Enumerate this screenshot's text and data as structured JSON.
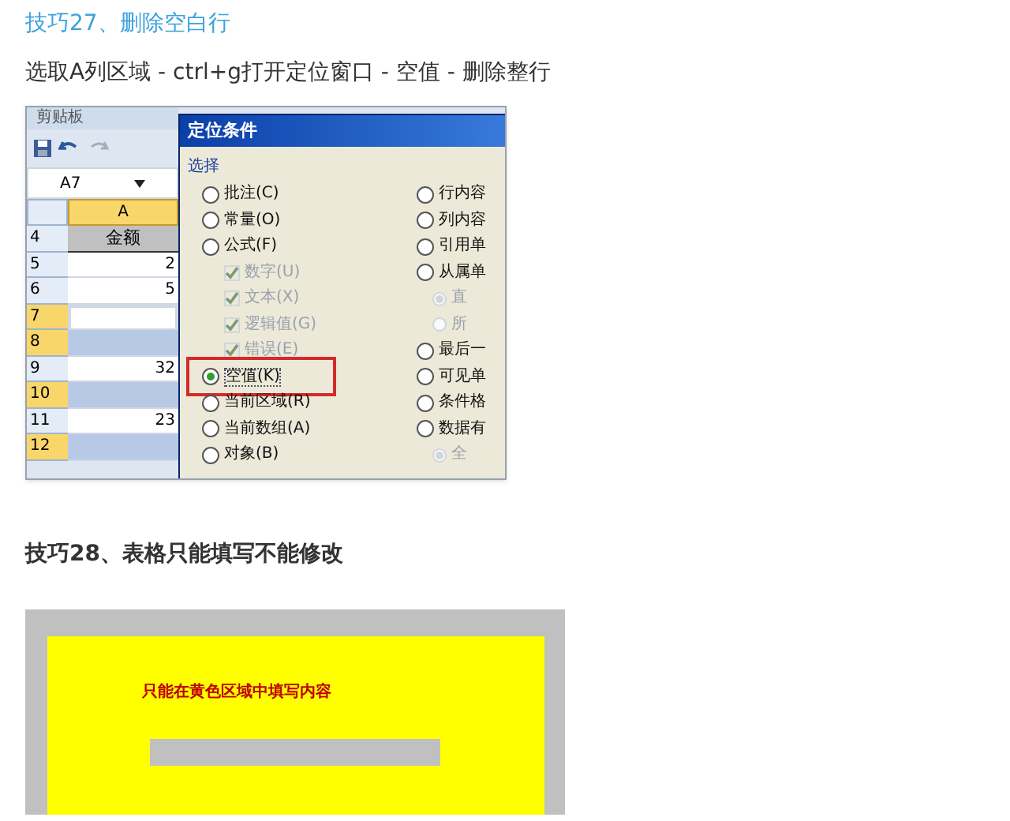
{
  "tip1": {
    "title": "技巧27、删除空白行",
    "description": "选取A列区域 - ctrl+g打开定位窗口 - 空值 - 删除整行"
  },
  "excel": {
    "ribbon_group": "剪贴板",
    "name_box": "A7",
    "column": "A",
    "rows": [
      {
        "number": "4",
        "value": "金额",
        "kind": "header",
        "selected": false
      },
      {
        "number": "5",
        "value": "2",
        "kind": "cell",
        "selected": false
      },
      {
        "number": "6",
        "value": "5",
        "kind": "cell",
        "selected": false
      },
      {
        "number": "7",
        "kind": "active",
        "selected": true
      },
      {
        "number": "8",
        "kind": "cell",
        "selected": true
      },
      {
        "number": "9",
        "value": "32",
        "kind": "cell",
        "selected": false
      },
      {
        "number": "10",
        "kind": "cell",
        "selected": true
      },
      {
        "number": "11",
        "value": "23",
        "kind": "cell",
        "selected": false
      },
      {
        "number": "12",
        "kind": "cell",
        "selected": true
      }
    ],
    "dialog": {
      "title": "定位条件",
      "group": "选择",
      "left_options": [
        {
          "label": "批注(C)",
          "kind": "radio",
          "selected": false,
          "disabled": false
        },
        {
          "label": "常量(O)",
          "kind": "radio",
          "selected": false,
          "disabled": false
        },
        {
          "label": "公式(F)",
          "kind": "radio",
          "selected": false,
          "disabled": false
        },
        {
          "label": "数字(U)",
          "kind": "checkbox",
          "checked": true,
          "disabled": true
        },
        {
          "label": "文本(X)",
          "kind": "checkbox",
          "checked": true,
          "disabled": true
        },
        {
          "label": "逻辑值(G)",
          "kind": "checkbox",
          "checked": true,
          "disabled": true
        },
        {
          "label": "错误(E)",
          "kind": "checkbox",
          "checked": true,
          "disabled": true
        },
        {
          "label": "空值(K)",
          "kind": "radio",
          "selected": true,
          "disabled": false,
          "highlighted": true
        },
        {
          "label": "当前区域(R)",
          "kind": "radio",
          "selected": false,
          "disabled": false
        },
        {
          "label": "当前数组(A)",
          "kind": "radio",
          "selected": false,
          "disabled": false
        },
        {
          "label": "对象(B)",
          "kind": "radio",
          "selected": false,
          "disabled": false
        }
      ],
      "right_options": [
        {
          "label": "行内容",
          "kind": "radio",
          "selected": false,
          "disabled": false
        },
        {
          "label": "列内容",
          "kind": "radio",
          "selected": false,
          "disabled": false
        },
        {
          "label": "引用单",
          "kind": "radio",
          "selected": false,
          "disabled": false
        },
        {
          "label": "从属单",
          "kind": "radio",
          "selected": false,
          "disabled": false
        },
        {
          "label": "直",
          "kind": "subradio",
          "selected": true,
          "disabled": true
        },
        {
          "label": "所",
          "kind": "subradio",
          "selected": false,
          "disabled": true
        },
        {
          "label": "最后一",
          "kind": "radio",
          "selected": false,
          "disabled": false
        },
        {
          "label": "可见单",
          "kind": "radio",
          "selected": false,
          "disabled": false
        },
        {
          "label": "条件格",
          "kind": "radio",
          "selected": false,
          "disabled": false
        },
        {
          "label": "数据有",
          "kind": "radio",
          "selected": false,
          "disabled": false
        },
        {
          "label": "全",
          "kind": "subradio",
          "selected": true,
          "disabled": true
        }
      ]
    }
  },
  "tip2": {
    "title": "技巧28、表格只能填写不能修改",
    "sheet_note": "只能在黄色区域中填写内容"
  }
}
